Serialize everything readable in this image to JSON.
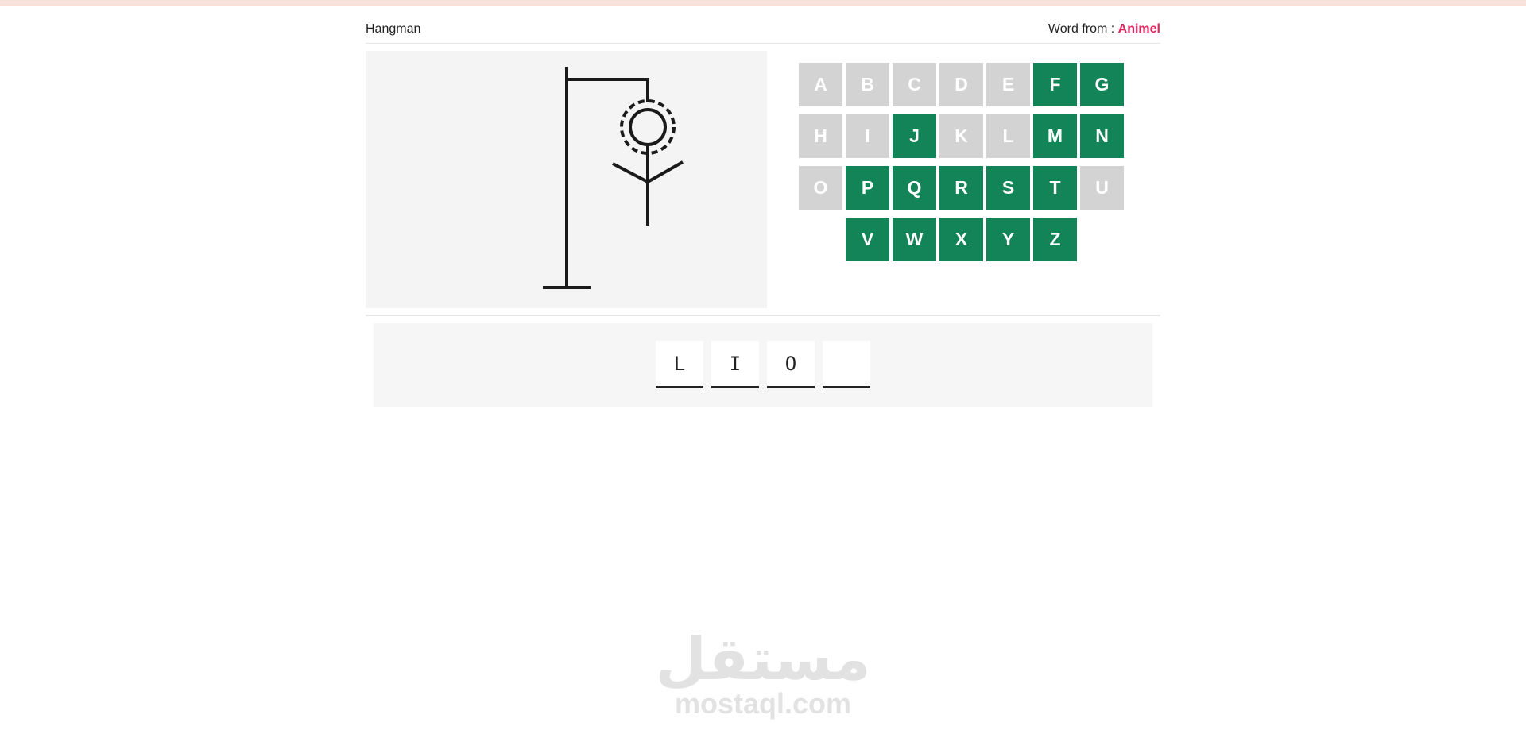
{
  "header": {
    "title": "Hangman",
    "category_label": "Word from :",
    "category_value": "Animel"
  },
  "keyboard": {
    "rows": [
      [
        {
          "letter": "A",
          "state": "used"
        },
        {
          "letter": "B",
          "state": "used"
        },
        {
          "letter": "C",
          "state": "used"
        },
        {
          "letter": "D",
          "state": "used"
        },
        {
          "letter": "E",
          "state": "used"
        },
        {
          "letter": "F",
          "state": "available"
        },
        {
          "letter": "G",
          "state": "available"
        }
      ],
      [
        {
          "letter": "H",
          "state": "used"
        },
        {
          "letter": "I",
          "state": "used"
        },
        {
          "letter": "J",
          "state": "available"
        },
        {
          "letter": "K",
          "state": "used"
        },
        {
          "letter": "L",
          "state": "used"
        },
        {
          "letter": "M",
          "state": "available"
        },
        {
          "letter": "N",
          "state": "available"
        }
      ],
      [
        {
          "letter": "O",
          "state": "used"
        },
        {
          "letter": "P",
          "state": "available"
        },
        {
          "letter": "Q",
          "state": "available"
        },
        {
          "letter": "R",
          "state": "available"
        },
        {
          "letter": "S",
          "state": "available"
        },
        {
          "letter": "T",
          "state": "available"
        },
        {
          "letter": "U",
          "state": "used"
        }
      ],
      [
        {
          "letter": "V",
          "state": "available"
        },
        {
          "letter": "W",
          "state": "available"
        },
        {
          "letter": "X",
          "state": "available"
        },
        {
          "letter": "Y",
          "state": "available"
        },
        {
          "letter": "Z",
          "state": "available"
        }
      ]
    ]
  },
  "word": {
    "slots": [
      "L",
      "I",
      "O",
      ""
    ]
  },
  "hangman": {
    "visible_parts": [
      "base",
      "pole",
      "beam",
      "rope",
      "head",
      "body",
      "left-arm",
      "right-arm"
    ]
  },
  "watermark": {
    "arabic": "مستقل",
    "latin": "mostaql.com"
  },
  "colors": {
    "available_key": "#138457",
    "used_key": "#d3d3d3",
    "category_accent": "#e0245e",
    "top_strip": "#f7e1dc"
  }
}
